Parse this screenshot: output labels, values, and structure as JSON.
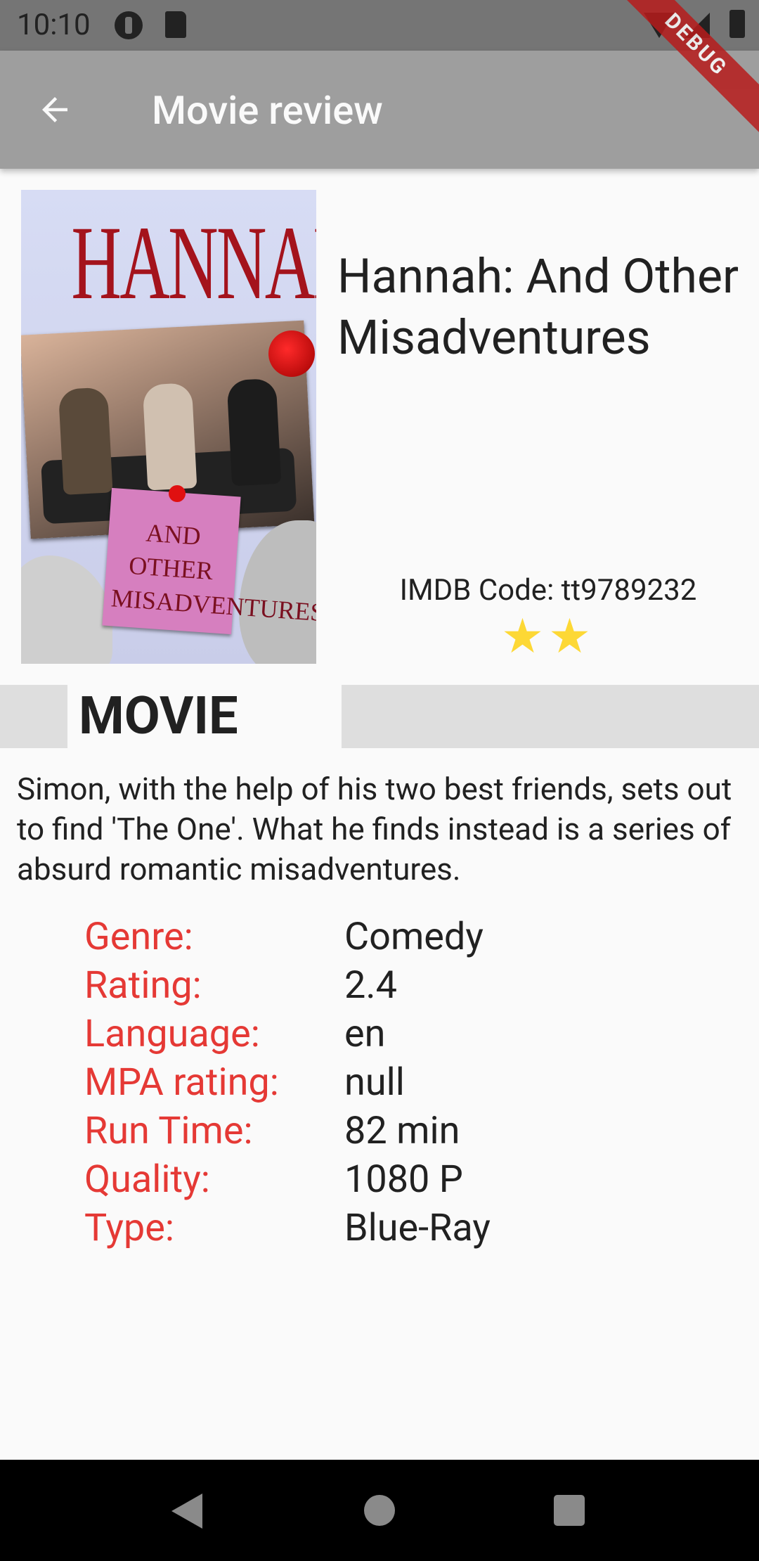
{
  "status_bar": {
    "time": "10:10",
    "icons": [
      "sync-icon",
      "sd-card-icon",
      "wifi-icon",
      "cell-signal-icon",
      "battery-icon"
    ]
  },
  "debug_banner": "DEBUG",
  "app_bar": {
    "title": "Movie review",
    "back_icon": "arrow-back-icon",
    "background_color": "#9e9e9e"
  },
  "poster": {
    "title_text": "HANNAH",
    "note_text": "AND OTHER MISADVENTURES"
  },
  "movie": {
    "title": "Hannah: And Other Misadventures",
    "imdb_code": "IMDB Code: tt9789232",
    "stars_display": "★★",
    "star_count": 2,
    "star_color": "#fdd835",
    "section_label": "MOVIE",
    "description": "Simon, with the help of his two best friends, sets out to find 'The One'. What he finds instead is a series of absurd romantic misadventures.",
    "details": [
      {
        "label": "Genre:",
        "value": "Comedy"
      },
      {
        "label": "Rating:",
        "value": "2.4"
      },
      {
        "label": "Language:",
        "value": "en"
      },
      {
        "label": "MPA rating:",
        "value": "null"
      },
      {
        "label": "Run Time:",
        "value": "82 min"
      },
      {
        "label": "Quality:",
        "value": "1080 P"
      },
      {
        "label": "Type:",
        "value": "Blue-Ray"
      }
    ],
    "label_color": "#e53935"
  },
  "nav_bar": {
    "buttons": [
      "nav-back-icon",
      "nav-home-icon",
      "nav-recents-icon"
    ]
  }
}
